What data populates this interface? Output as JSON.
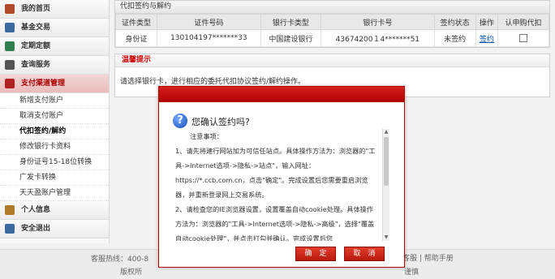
{
  "sidebar": {
    "items": [
      {
        "label": "我的首页",
        "icon": "home-icon",
        "color": "#b04a2a"
      },
      {
        "label": "基金交易",
        "icon": "fund-icon",
        "color": "#3a6aa0"
      },
      {
        "label": "定期定额",
        "icon": "calendar-icon",
        "color": "#2f7f4f"
      },
      {
        "label": "查询服务",
        "icon": "query-icon",
        "color": "#555555"
      },
      {
        "label": "支付渠道管理",
        "icon": "payment-icon",
        "color": "#b02020"
      }
    ],
    "sub_items": [
      "新增支付账户",
      "取消支付账户",
      "代扣签约/解约",
      "修改银行卡资料",
      "身份证号15-18位转换",
      "广发卡转换",
      "天天盈账户管理"
    ],
    "bottom_items": [
      {
        "label": "个人信息",
        "icon": "user-icon",
        "color": "#b07a2a"
      },
      {
        "label": "安全退出",
        "icon": "power-icon",
        "color": "#3a6aa0"
      }
    ]
  },
  "panel": {
    "title": "代扣签约与解约",
    "headers": [
      "证件类型",
      "证件号码",
      "银行卡类型",
      "银行卡号",
      "签约状态",
      "操作",
      "认申购代扣"
    ],
    "row": [
      "身份证",
      "130104197*******33",
      "中国建设银行",
      "43674200１4*******51",
      "未签约",
      "签约",
      ""
    ]
  },
  "warning": {
    "title": "温馨提示",
    "body": "请选择银行卡，进行相应的委托代扣协议签约/解约操作。"
  },
  "footer": {
    "hotline": "客服热线：400-8",
    "copyright": "版权所",
    "links": "客服 | 帮助手册",
    "suffix": "谨慎"
  },
  "dialog": {
    "title": "您确认签约吗?",
    "note_label": "注意事项：",
    "paragraphs": [
      "1、请先将建行网站加为可信任站点。具体操作方法为：浏览器的\"工具->Internet选项->隐私->站点\"，输入网址：https://*.ccb.com.cn，点击\"确定\"。完成设置后您需要重启浏览器，并重新登录网上交易系统。",
      "2、请检查您的IE浏览器设置，设置覆盖自动cookie处理。具体操作方法为：浏览器的\"工具->Internet选项->隐私->高级\"，选择\"覆盖自动cookie处理\"，并点击打勾并确认。完成设置后您"
    ],
    "confirm": "确　定",
    "cancel": "取　消"
  }
}
